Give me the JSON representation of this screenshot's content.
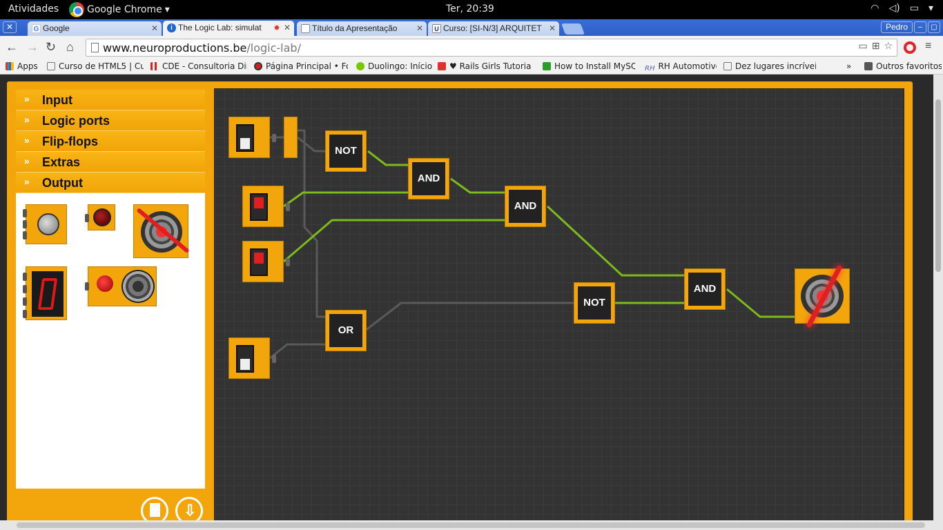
{
  "os_bar": {
    "activities": "Atividades",
    "app_name": "Google Chrome",
    "clock": "Ter, 20:39"
  },
  "tabs": [
    {
      "title": "Google",
      "favicon": "google-icon"
    },
    {
      "title": "The Logic Lab: simulat",
      "favicon": "logiclab-icon",
      "active": true
    },
    {
      "title": "Título da Apresentação",
      "favicon": "page-icon"
    },
    {
      "title": "Curso: [SI-N/3] ARQUITET",
      "favicon": "uni-icon"
    }
  ],
  "profile_name": "Pedro",
  "address": {
    "host": "www.neuroproductions.be",
    "path": "/logic-lab/"
  },
  "bookmarks": [
    {
      "label": "Apps",
      "icon": "apps-grid-icon",
      "color": "#d33"
    },
    {
      "label": "Curso de HTML5 | Cu",
      "icon": "page-icon",
      "color": "#ffffff"
    },
    {
      "label": "CDE - Consultoria Dire",
      "icon": "cde-icon",
      "color": "#e02020"
    },
    {
      "label": "Página Principal • Fór",
      "icon": "record-icon",
      "color": "#d02020"
    },
    {
      "label": "Duolingo: Início",
      "icon": "duolingo-icon",
      "color": "#78c800"
    },
    {
      "label": "♥ Rails Girls Tutorial",
      "icon": "heart-icon",
      "color": "#e03030"
    },
    {
      "label": "How to Install MySQL",
      "icon": "cube-icon",
      "color": "#2a9d2a"
    },
    {
      "label": "RH Automotive",
      "icon": "rh-icon",
      "color": "#5566aa"
    },
    {
      "label": "Dez lugares incríveis",
      "icon": "page-icon",
      "color": "#ffffff"
    },
    {
      "label": "Outros favoritos",
      "icon": "folder-icon",
      "color": "#555555"
    }
  ],
  "sidebar": {
    "categories": [
      "Input",
      "Logic ports",
      "Flip-flops",
      "Extras",
      "Output"
    ]
  },
  "circuit": {
    "gates": [
      "NOT",
      "AND",
      "AND",
      "OR",
      "NOT",
      "AND"
    ]
  },
  "colors": {
    "frame": "#f2a60c",
    "wire_on": "#7dbb1a",
    "wire_off": "#5a5a5a"
  }
}
